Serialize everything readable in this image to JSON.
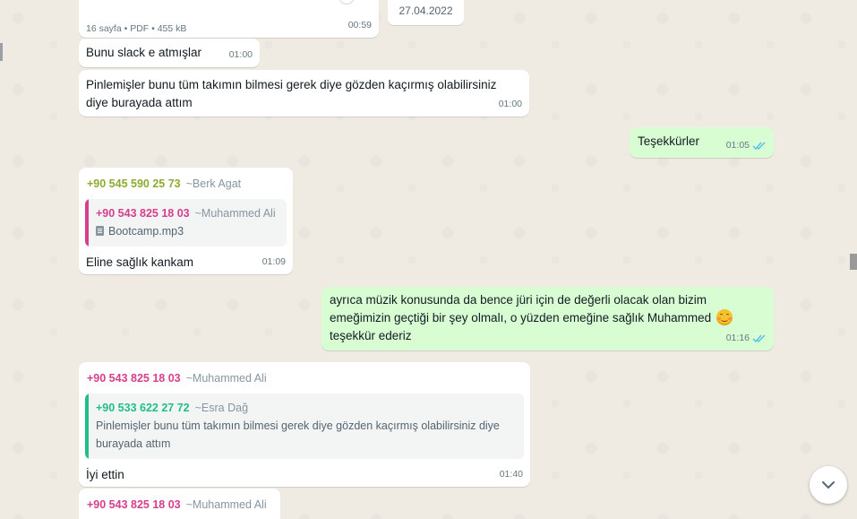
{
  "date_chip": "27.04.2022",
  "messages": {
    "m0": {
      "meta": "16 sayfa • PDF • 455 kB",
      "time": "00:59"
    },
    "m1": {
      "text": "Bunu slack e atmışlar",
      "time": "01:00"
    },
    "m2": {
      "text_line1": "Pinlemişler bunu tüm takımın bilmesi gerek diye gözden kaçırmış olabilirsiniz",
      "text_line2": "diye burayada attım",
      "time": "01:00"
    },
    "m3": {
      "text": "Teşekkürler",
      "time": "01:05"
    },
    "m4": {
      "sender": "+90 545 590 25 73",
      "alias": "~Berk Agat",
      "quote_sender": "+90 543 825 18 03",
      "quote_alias": "~Muhammed Ali",
      "quote_file": "Bootcamp.mp3",
      "text": "Eline sağlık kankam",
      "time": "01:09"
    },
    "m5": {
      "line1": "ayrıca müzik konusunda da bence jüri için de değerli olacak olan bizim",
      "line2": "emeğimizin geçtiği bir şey olmalı, o yüzden emeğine sağlık Muhammed",
      "line3": "teşekkür ederiz",
      "emoji": "smiling-face-emoji",
      "time": "01:16"
    },
    "m6": {
      "sender": "+90 543 825 18 03",
      "alias": "~Muhammed Ali",
      "quote_sender": "+90 533 622 27 72",
      "quote_alias": "~Esra Dağ",
      "quote_line1": "Pinlemişler bunu tüm takımın bilmesi gerek diye gözden kaçırmış olabilirsiniz diye",
      "quote_line2": "burayada attım",
      "text": "İyi ettin",
      "time": "01:40"
    },
    "m7": {
      "sender": "+90 543 825 18 03",
      "alias": "~Muhammed Ali"
    }
  },
  "colors": {
    "sender_green": "#8cab2f",
    "sender_pink": "#d63f8c",
    "sender_teal": "#1fbf8a",
    "read_ticks": "#53bdeb"
  },
  "icons": {
    "read": "double-check-icon",
    "scroll_down": "chevron-down-icon",
    "file": "document-icon"
  }
}
